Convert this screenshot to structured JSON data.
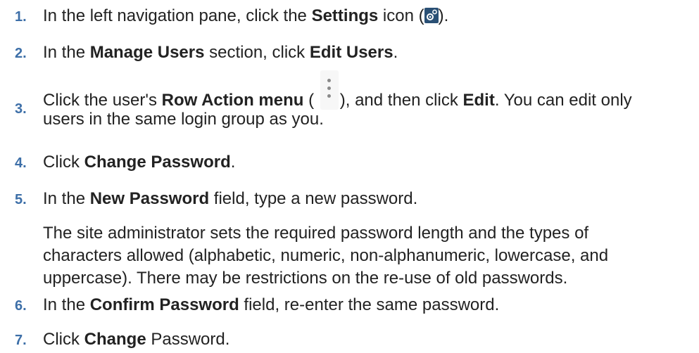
{
  "steps": [
    {
      "number": "1.",
      "parts": [
        "In the left navigation pane, click the ",
        "Settings",
        " icon (",
        ")."
      ]
    },
    {
      "number": "2.",
      "parts": [
        "In the ",
        "Manage Users",
        " section, click ",
        "Edit Users",
        "."
      ]
    },
    {
      "number": "3.",
      "parts": [
        "Click the user's ",
        "Row Action menu",
        " ( ",
        "), and then click ",
        "Edit",
        ". You can edit only",
        "users in the same login group as you."
      ]
    },
    {
      "number": "4.",
      "parts": [
        "Click ",
        "Change Password",
        "."
      ]
    },
    {
      "number": "5.",
      "parts": [
        "In the ",
        "New Password",
        " field, type a new password."
      ]
    },
    {
      "note": [
        "The site administrator sets the required password length and the types of",
        "characters allowed (alphabetic, numeric, non-alphanumeric, lowercase, and",
        "uppercase). There may be restrictions on the re-use of old passwords."
      ]
    },
    {
      "number": "6.",
      "parts": [
        "In the ",
        "Confirm Password",
        " field, re-enter the same password."
      ]
    },
    {
      "number": "7.",
      "parts": [
        "Click ",
        "Change",
        " Password."
      ]
    }
  ],
  "icons": {
    "settings": "settings-icon",
    "row_action": "row-action-menu-icon"
  },
  "colors": {
    "step_number": "#3d6fa8",
    "settings_icon_bg": "#2a5075",
    "text": "#222222"
  }
}
